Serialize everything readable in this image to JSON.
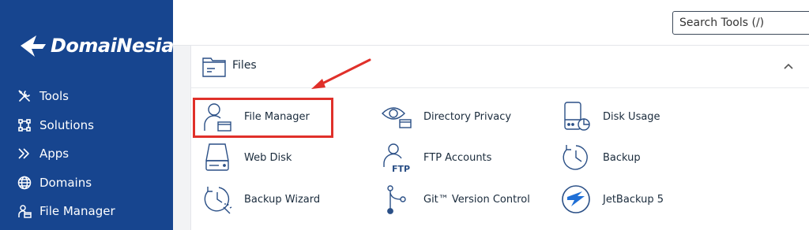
{
  "brand": {
    "name": "DomaiNesia"
  },
  "sidebar": {
    "items": [
      {
        "label": "Tools",
        "icon": "tools-icon"
      },
      {
        "label": "Solutions",
        "icon": "solutions-icon"
      },
      {
        "label": "Apps",
        "icon": "apps-icon"
      },
      {
        "label": "Domains",
        "icon": "globe-icon"
      },
      {
        "label": "File Manager",
        "icon": "file-manager-icon"
      }
    ]
  },
  "search": {
    "placeholder": "Search Tools (/)"
  },
  "section": {
    "title": "Files",
    "tools": [
      {
        "label": "File Manager",
        "icon": "file-manager-icon"
      },
      {
        "label": "Directory Privacy",
        "icon": "directory-privacy-icon"
      },
      {
        "label": "Disk Usage",
        "icon": "disk-usage-icon"
      },
      {
        "label": "Web Disk",
        "icon": "web-disk-icon"
      },
      {
        "label": "FTP Accounts",
        "icon": "ftp-accounts-icon"
      },
      {
        "label": "Backup",
        "icon": "backup-icon"
      },
      {
        "label": "Backup Wizard",
        "icon": "backup-wizard-icon"
      },
      {
        "label": "Git™ Version Control",
        "icon": "git-icon"
      },
      {
        "label": "JetBackup 5",
        "icon": "jetbackup-icon"
      }
    ]
  },
  "colors": {
    "sidebar": "#17458f",
    "icon": "#2a4f86",
    "highlight": "#e0302a"
  }
}
